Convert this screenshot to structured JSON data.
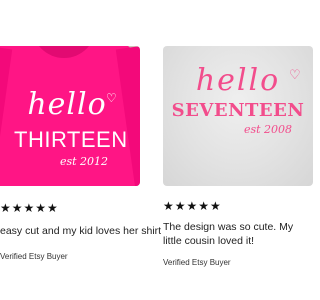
{
  "reviews": [
    {
      "product": {
        "greeting": "hello",
        "number": "THIRTEEN",
        "established": "est 2012",
        "shirt_color": "#ff1585",
        "print_color": "#ffffff"
      },
      "stars": "★★★★★",
      "rating": 5,
      "text": "easy cut and my kid loves her shirt",
      "buyer": "Verified Etsy Buyer"
    },
    {
      "product": {
        "greeting": "hello",
        "number": "SEVENTEEN",
        "established": "est 2008",
        "shirt_color": "#e4e4e4",
        "print_color": "#f24d8c"
      },
      "stars": "★★★★★",
      "rating": 5,
      "text": "The design was so cute. My little cousin loved it!",
      "buyer": "Verified Etsy Buyer"
    }
  ]
}
